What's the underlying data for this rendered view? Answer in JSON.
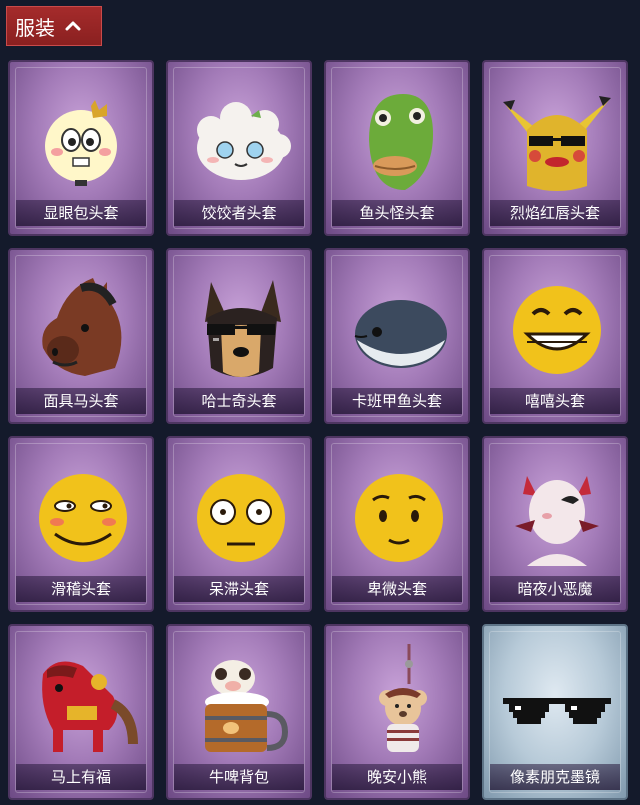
{
  "category": {
    "label": "服装",
    "icon": "chevron-up-icon"
  },
  "items": [
    {
      "name": "显眼包头套",
      "icon": "bright-face-mask-icon"
    },
    {
      "name": "饺饺者头套",
      "icon": "dumpling-mask-icon"
    },
    {
      "name": "鱼头怪头套",
      "icon": "fish-head-mask-icon"
    },
    {
      "name": "烈焰红唇头套",
      "icon": "red-lips-mask-icon"
    },
    {
      "name": "面具马头套",
      "icon": "horse-mask-icon"
    },
    {
      "name": "哈士奇头套",
      "icon": "husky-mask-icon"
    },
    {
      "name": "卡班甲鱼头套",
      "icon": "fish-mask-icon"
    },
    {
      "name": "嘻嘻头套",
      "icon": "grin-emoji-mask-icon"
    },
    {
      "name": "滑稽头套",
      "icon": "funny-emoji-mask-icon"
    },
    {
      "name": "呆滞头套",
      "icon": "dazed-emoji-mask-icon"
    },
    {
      "name": "卑微头套",
      "icon": "humble-emoji-mask-icon"
    },
    {
      "name": "暗夜小恶魔",
      "icon": "little-devil-icon"
    },
    {
      "name": "马上有福",
      "icon": "red-horse-icon"
    },
    {
      "name": "牛啤背包",
      "icon": "beer-mug-backpack-icon"
    },
    {
      "name": "晚安小熊",
      "icon": "bear-pendant-icon"
    },
    {
      "name": "像素朋克墨镜",
      "icon": "pixel-sunglasses-icon"
    }
  ]
}
